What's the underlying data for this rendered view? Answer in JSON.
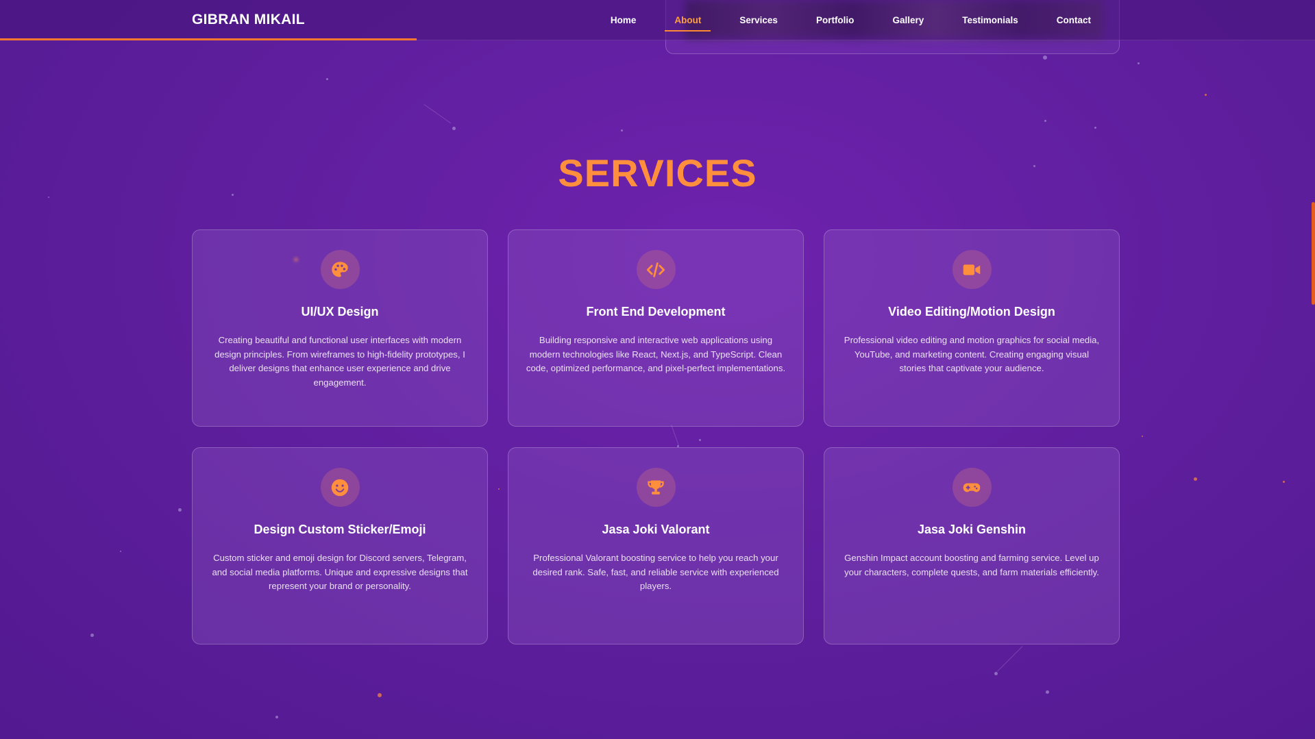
{
  "header": {
    "brand": "GIBRAN MIKAIL",
    "nav": [
      {
        "label": "Home",
        "active": false
      },
      {
        "label": "About",
        "active": true
      },
      {
        "label": "Services",
        "active": false
      },
      {
        "label": "Portfolio",
        "active": false
      },
      {
        "label": "Gallery",
        "active": false
      },
      {
        "label": "Testimonials",
        "active": false
      },
      {
        "label": "Contact",
        "active": false
      }
    ],
    "accent_color": "#ff7a2f"
  },
  "services": {
    "title": "SERVICES",
    "cards": [
      {
        "icon": "palette-icon",
        "title": "UI/UX Design",
        "description": "Creating beautiful and functional user interfaces with modern design principles. From wireframes to high-fidelity prototypes, I deliver designs that enhance user experience and drive engagement."
      },
      {
        "icon": "code-icon",
        "title": "Front End Development",
        "description": "Building responsive and interactive web applications using modern technologies like React, Next.js, and TypeScript. Clean code, optimized performance, and pixel-perfect implementations."
      },
      {
        "icon": "video-camera-icon",
        "title": "Video Editing/Motion Design",
        "description": "Professional video editing and motion graphics for social media, YouTube, and marketing content. Creating engaging visual stories that captivate your audience."
      },
      {
        "icon": "smile-icon",
        "title": "Design Custom Sticker/Emoji",
        "description": "Custom sticker and emoji design for Discord servers, Telegram, and social media platforms. Unique and expressive designs that represent your brand or personality."
      },
      {
        "icon": "trophy-icon",
        "title": "Jasa Joki Valorant",
        "description": "Professional Valorant boosting service to help you reach your desired rank. Safe, fast, and reliable service with experienced players."
      },
      {
        "icon": "gamepad-icon",
        "title": "Jasa Joki Genshin",
        "description": "Genshin Impact account boosting and farming service. Level up your characters, complete quests, and farm materials efficiently."
      }
    ]
  },
  "colors": {
    "background": "#601f9f",
    "title": "#ff8f3c",
    "icon": "#ff8f3c"
  }
}
